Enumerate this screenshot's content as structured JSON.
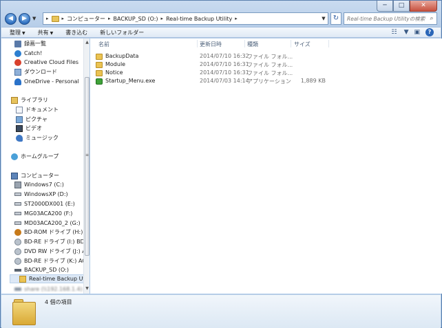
{
  "window": {
    "caption_buttons": {
      "minimize": "─",
      "maximize": "□",
      "close": "✕"
    }
  },
  "address": {
    "breadcrumbs": [
      "コンピューター",
      "BACKUP_SD (O:)",
      "Real-time Backup Utility"
    ],
    "separator": "▸",
    "search_placeholder": "Real-time Backup Utilityの検索",
    "back_glyph": "◀",
    "forward_glyph": "▶",
    "refresh_glyph": "↻",
    "search_glyph": "⌕"
  },
  "toolbar": {
    "organize": "整理",
    "share": "共有",
    "burn": "書き込む",
    "new_folder": "新しいフォルダー",
    "dropdown_glyph": "▼",
    "view_glyph": "☷",
    "preview_glyph": "▣",
    "help_glyph": "?"
  },
  "nav": {
    "favorites": [
      {
        "label": "録画一覧",
        "icon": "recording-icon"
      },
      {
        "label": "Catch!",
        "icon": "catch-icon"
      },
      {
        "label": "Creative Cloud Files",
        "icon": "creative-cloud-icon"
      },
      {
        "label": "ダウンロード",
        "icon": "download-icon"
      },
      {
        "label": "OneDrive - Personal",
        "icon": "onedrive-icon"
      }
    ],
    "libraries_header": "ライブラリ",
    "libraries": [
      {
        "label": "ドキュメント",
        "icon": "documents-icon"
      },
      {
        "label": "ピクチャ",
        "icon": "pictures-icon"
      },
      {
        "label": "ビデオ",
        "icon": "videos-icon"
      },
      {
        "label": "ミュージック",
        "icon": "music-icon"
      }
    ],
    "homegroup": "ホームグループ",
    "computer_header": "コンピューター",
    "drives": [
      {
        "label": "Windows7 (C:)",
        "icon": "system-drive-icon"
      },
      {
        "label": "WindowsXP (D:)",
        "icon": "hard-drive-icon"
      },
      {
        "label": "ST2000DX001 (E:)",
        "icon": "hard-drive-icon"
      },
      {
        "label": "MG03ACA200 (F:)",
        "icon": "hard-drive-icon"
      },
      {
        "label": "MD03ACA200_2 (G:)",
        "icon": "hard-drive-icon"
      },
      {
        "label": "BD-ROM ドライブ (H:) PU",
        "icon": "bd-rom-icon"
      },
      {
        "label": "BD-RE ドライブ (I:) BDRO",
        "icon": "bd-re-icon"
      },
      {
        "label": "DVD RW ドライブ (J:) Aud",
        "icon": "dvd-rw-icon"
      },
      {
        "label": "BD-RE ドライブ (K:) AQOU",
        "icon": "bd-re-icon"
      },
      {
        "label": "BACKUP_SD (O:)",
        "icon": "sd-card-icon"
      }
    ],
    "selected_folder": "Real-time Backup Utility",
    "blurred_item": "share (\\\\192.168.1.4) (Y:)"
  },
  "files": {
    "columns": {
      "name": "名前",
      "date": "更新日時",
      "type": "種類",
      "size": "サイズ"
    },
    "rows": [
      {
        "name": "BackupData",
        "date": "2014/07/10 16:32",
        "type": "ファイル フォル...",
        "size": "",
        "icon": "folder-icon"
      },
      {
        "name": "Module",
        "date": "2014/07/10 16:31",
        "type": "ファイル フォル...",
        "size": "",
        "icon": "folder-icon"
      },
      {
        "name": "Notice",
        "date": "2014/07/10 16:31",
        "type": "ファイル フォル...",
        "size": "",
        "icon": "folder-icon"
      },
      {
        "name": "Startup_Menu.exe",
        "date": "2014/07/03 14:14",
        "type": "アプリケーション",
        "size": "1,889 KB",
        "icon": "exe-icon"
      }
    ]
  },
  "details": {
    "item_count": "4 個の項目"
  },
  "scroll": {
    "up": "▲",
    "down": "▼",
    "grip": "≡"
  }
}
